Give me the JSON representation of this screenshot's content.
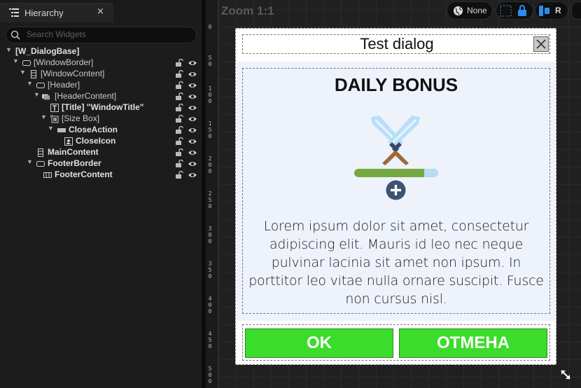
{
  "hierarchy": {
    "tab_title": "Hierarchy",
    "close_glyph": "×",
    "search_placeholder": "Search Widgets",
    "rows": [
      {
        "label": "[W_DialogBase]",
        "bold": true
      },
      {
        "label": "[WindowBorder]",
        "bold": false
      },
      {
        "label": "[WindowContent]",
        "bold": false
      },
      {
        "label": "[Header]",
        "bold": false
      },
      {
        "label": "[HeaderContent]",
        "bold": false
      },
      {
        "label": "[Title] \"WindowTitle\"",
        "bold": true
      },
      {
        "label": "[Size Box]",
        "bold": false
      },
      {
        "label": "CloseAction",
        "bold": true
      },
      {
        "label": "CloseIcon",
        "bold": true
      },
      {
        "label": "MainContent",
        "bold": true
      },
      {
        "label": "FooterBorder",
        "bold": true
      },
      {
        "label": "FooterContent",
        "bold": true
      }
    ]
  },
  "designer": {
    "zoom_label": "Zoom 1:1",
    "locale_label": "None",
    "r_label": "R",
    "ruler_labels": [
      "0",
      "5 0",
      "1 0 0",
      "1 5 0",
      "2 0 0",
      "2 5 0",
      "3 0 0",
      "3 5 0",
      "4 0 0",
      "4 5 0",
      "5 0 0"
    ]
  },
  "dialog": {
    "title": "Test dialog",
    "heading": "DAILY BONUS",
    "body": "Lorem ipsum dolor sit amet, consectetur adipiscing elit. Mauris id leo nec neque pulvinar lacinia sit amet non ipsum. In porttitor leo vitae nulla ornare suscipit. Fusce non cursus nisl.",
    "progress_fraction": 0.83,
    "ok_label": "OK",
    "cancel_label": "ОТМЕНА"
  },
  "colors": {
    "button_green": "#3bdc2b",
    "progress_fill": "#76a942",
    "progress_track": "#b6dcf6",
    "content_bg": "#eef2fb"
  }
}
